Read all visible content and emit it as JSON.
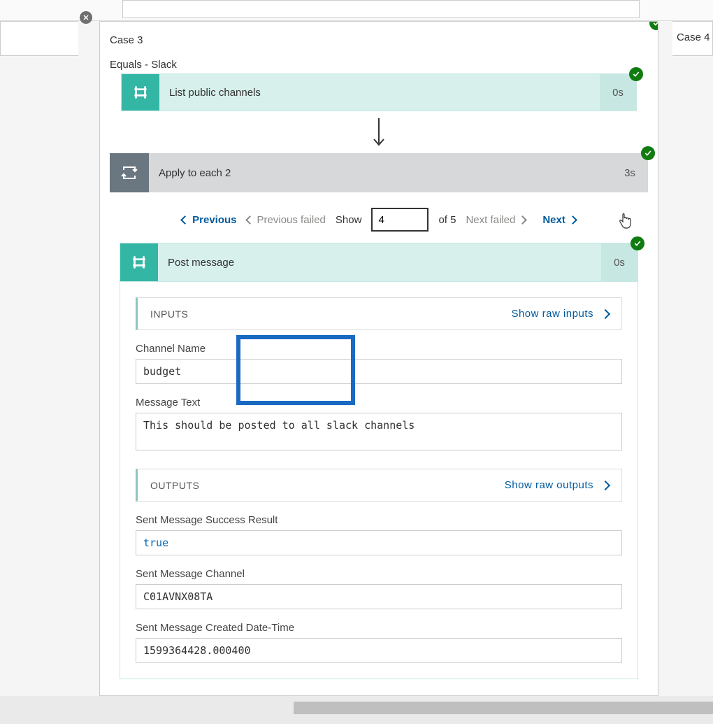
{
  "topStrip": {},
  "caseTabLeft": "",
  "caseTabRight": "Case 4",
  "mainCard": {
    "title": "Case 3",
    "subtitle": "Equals - Slack"
  },
  "listChannels": {
    "label": "List public channels",
    "duration": "0s"
  },
  "loop": {
    "label": "Apply to each 2",
    "duration": "3s",
    "pager": {
      "previous": "Previous",
      "previousFailed": "Previous failed",
      "showLabel": "Show",
      "showValue": "4",
      "ofTotal": "of 5",
      "nextFailed": "Next failed",
      "next": "Next"
    }
  },
  "postMessage": {
    "label": "Post message",
    "duration": "0s",
    "inputs": {
      "heading": "INPUTS",
      "showRaw": "Show raw inputs",
      "channelName": {
        "label": "Channel Name",
        "value": "budget"
      },
      "messageText": {
        "label": "Message Text",
        "value": "This should be posted to all slack channels"
      }
    },
    "outputs": {
      "heading": "OUTPUTS",
      "showRaw": "Show raw outputs",
      "success": {
        "label": "Sent Message Success Result",
        "value": "true"
      },
      "channel": {
        "label": "Sent Message Channel",
        "value": "C01AVNX08TA"
      },
      "created": {
        "label": "Sent Message Created Date-Time",
        "value": "1599364428.000400"
      }
    }
  }
}
